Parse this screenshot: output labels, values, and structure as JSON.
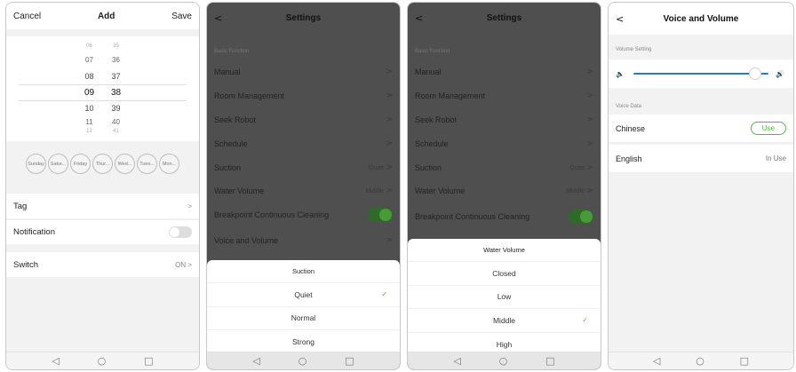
{
  "screen1": {
    "topbar": {
      "cancel": "Cancel",
      "title": "Add",
      "save": "Save"
    },
    "picker": {
      "rows": [
        {
          "h": "06",
          "m": "35"
        },
        {
          "h": "07",
          "m": "36"
        },
        {
          "h": "08",
          "m": "37"
        },
        {
          "h": "09",
          "m": "38"
        },
        {
          "h": "10",
          "m": "39"
        },
        {
          "h": "11",
          "m": "40"
        },
        {
          "h": "12",
          "m": "41"
        }
      ],
      "selected": {
        "h": "09",
        "m": "38"
      }
    },
    "days": [
      "Sunday",
      "Satur...",
      "Friday",
      "Thur...",
      "Wed...",
      "Tues...",
      "Mon..."
    ],
    "tag": {
      "label": "Tag",
      "chevron": ">"
    },
    "notification": {
      "label": "Notification",
      "enabled": false
    },
    "switch": {
      "label": "Switch",
      "value": "ON >"
    }
  },
  "screen2": {
    "header": {
      "back": "<",
      "title": "Settings"
    },
    "section": "Basic Function",
    "items": [
      {
        "label": "Manual",
        "value": "",
        "chev": ">"
      },
      {
        "label": "Room Management",
        "value": "",
        "chev": ">"
      },
      {
        "label": "Seek Robot",
        "value": "",
        "chev": ">"
      },
      {
        "label": "Schedule",
        "value": "",
        "chev": ">"
      },
      {
        "label": "Suction",
        "value": "Quiet",
        "chev": ">"
      },
      {
        "label": "Water Volume",
        "value": "Middle",
        "chev": ">"
      },
      {
        "label": "Breakpoint Continuous Cleaning",
        "value": "",
        "chev": ""
      },
      {
        "label": "Voice and Volume",
        "value": "",
        "chev": ">"
      }
    ],
    "sheet": {
      "title": "Suction",
      "options": [
        "Quiet",
        "Normal",
        "Strong"
      ],
      "selected": "Quiet"
    }
  },
  "screen3": {
    "header": {
      "back": "<",
      "title": "Settings"
    },
    "section": "Basic Function",
    "items": [
      {
        "label": "Manual",
        "value": "",
        "chev": ">"
      },
      {
        "label": "Room Management",
        "value": "",
        "chev": ">"
      },
      {
        "label": "Seek Robot",
        "value": "",
        "chev": ">"
      },
      {
        "label": "Schedule",
        "value": "",
        "chev": ">"
      },
      {
        "label": "Suction",
        "value": "Quiet",
        "chev": ">"
      },
      {
        "label": "Water Volume",
        "value": "Middle",
        "chev": ">"
      },
      {
        "label": "Breakpoint Continuous Cleaning",
        "value": "",
        "chev": ""
      }
    ],
    "sheet": {
      "title": "Water Volume",
      "options": [
        "Closed",
        "Low",
        "Middle",
        "High"
      ],
      "selected": "Middle"
    }
  },
  "screen4": {
    "header": {
      "back": "<",
      "title": "Voice and Volume"
    },
    "volume_label": "Volume Setting",
    "volume_level": 0.9,
    "voice_label": "Voice Data",
    "voices": [
      {
        "name": "Chinese",
        "action": "Use"
      },
      {
        "name": "English",
        "action": "In Use"
      }
    ]
  },
  "nav": {
    "back": "◁",
    "home": "○",
    "recent": "□"
  },
  "colors": {
    "accent_green": "#55b44b",
    "slider_blue": "#2d77c9",
    "overlay": "#4f4f4f"
  }
}
